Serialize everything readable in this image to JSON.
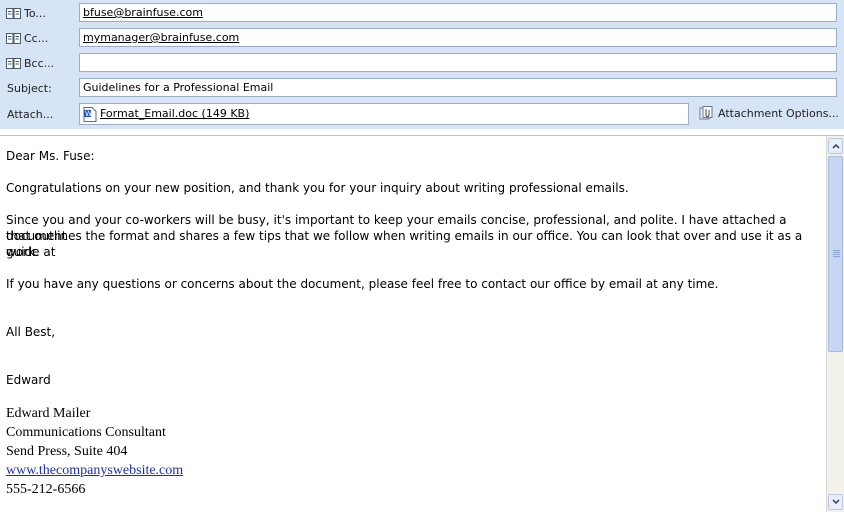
{
  "header": {
    "to": {
      "label": "To...",
      "value": "bfuse@brainfuse.com"
    },
    "cc": {
      "label": "Cc...",
      "value": "mymanager@brainfuse.com"
    },
    "bcc": {
      "label": "Bcc...",
      "value": ""
    },
    "subject": {
      "label": "Subject:",
      "value": "Guidelines for a Professional Email"
    },
    "attach": {
      "label": "Attach...",
      "file": "Format_Email.doc (149 KB)",
      "options_label": "Attachment Options..."
    }
  },
  "body": {
    "greeting": "Dear Ms. Fuse:",
    "para1": "Congratulations on your new position, and thank you for your inquiry about writing professional emails.",
    "para2_line1": "Since you and your co-workers will be busy, it's important to keep your emails concise, professional, and polite. I have attached a document",
    "para2_line2": "that outlines the format and shares a few tips that we follow when writing emails in our office. You can look that over and use it as a guide at",
    "para2_line3": "work.",
    "para3": "If you have any questions or concerns about the document, please feel free to contact our office by email at any time.",
    "closing": "All Best,",
    "sender_first": "Edward"
  },
  "signature": {
    "name": "Edward Mailer",
    "title": "Communications Consultant",
    "company": "Send Press, Suite 404",
    "website": "www.thecompanyswebsite.com",
    "phone": "555-212-6566"
  }
}
